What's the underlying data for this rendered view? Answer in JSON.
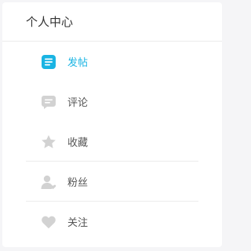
{
  "header": {
    "title": "个人中心"
  },
  "menu": {
    "items": [
      {
        "label": "发帖",
        "icon": "post-icon",
        "active": true
      },
      {
        "label": "评论",
        "icon": "comment-icon",
        "active": false
      },
      {
        "label": "收藏",
        "icon": "star-icon",
        "active": false
      },
      {
        "label": "粉丝",
        "icon": "fans-icon",
        "active": false
      },
      {
        "label": "关注",
        "icon": "heart-icon",
        "active": false
      }
    ]
  },
  "colors": {
    "accent": "#1ab4e3",
    "icon_inactive": "#d2d2d2",
    "text": "#555555",
    "title": "#333333"
  }
}
